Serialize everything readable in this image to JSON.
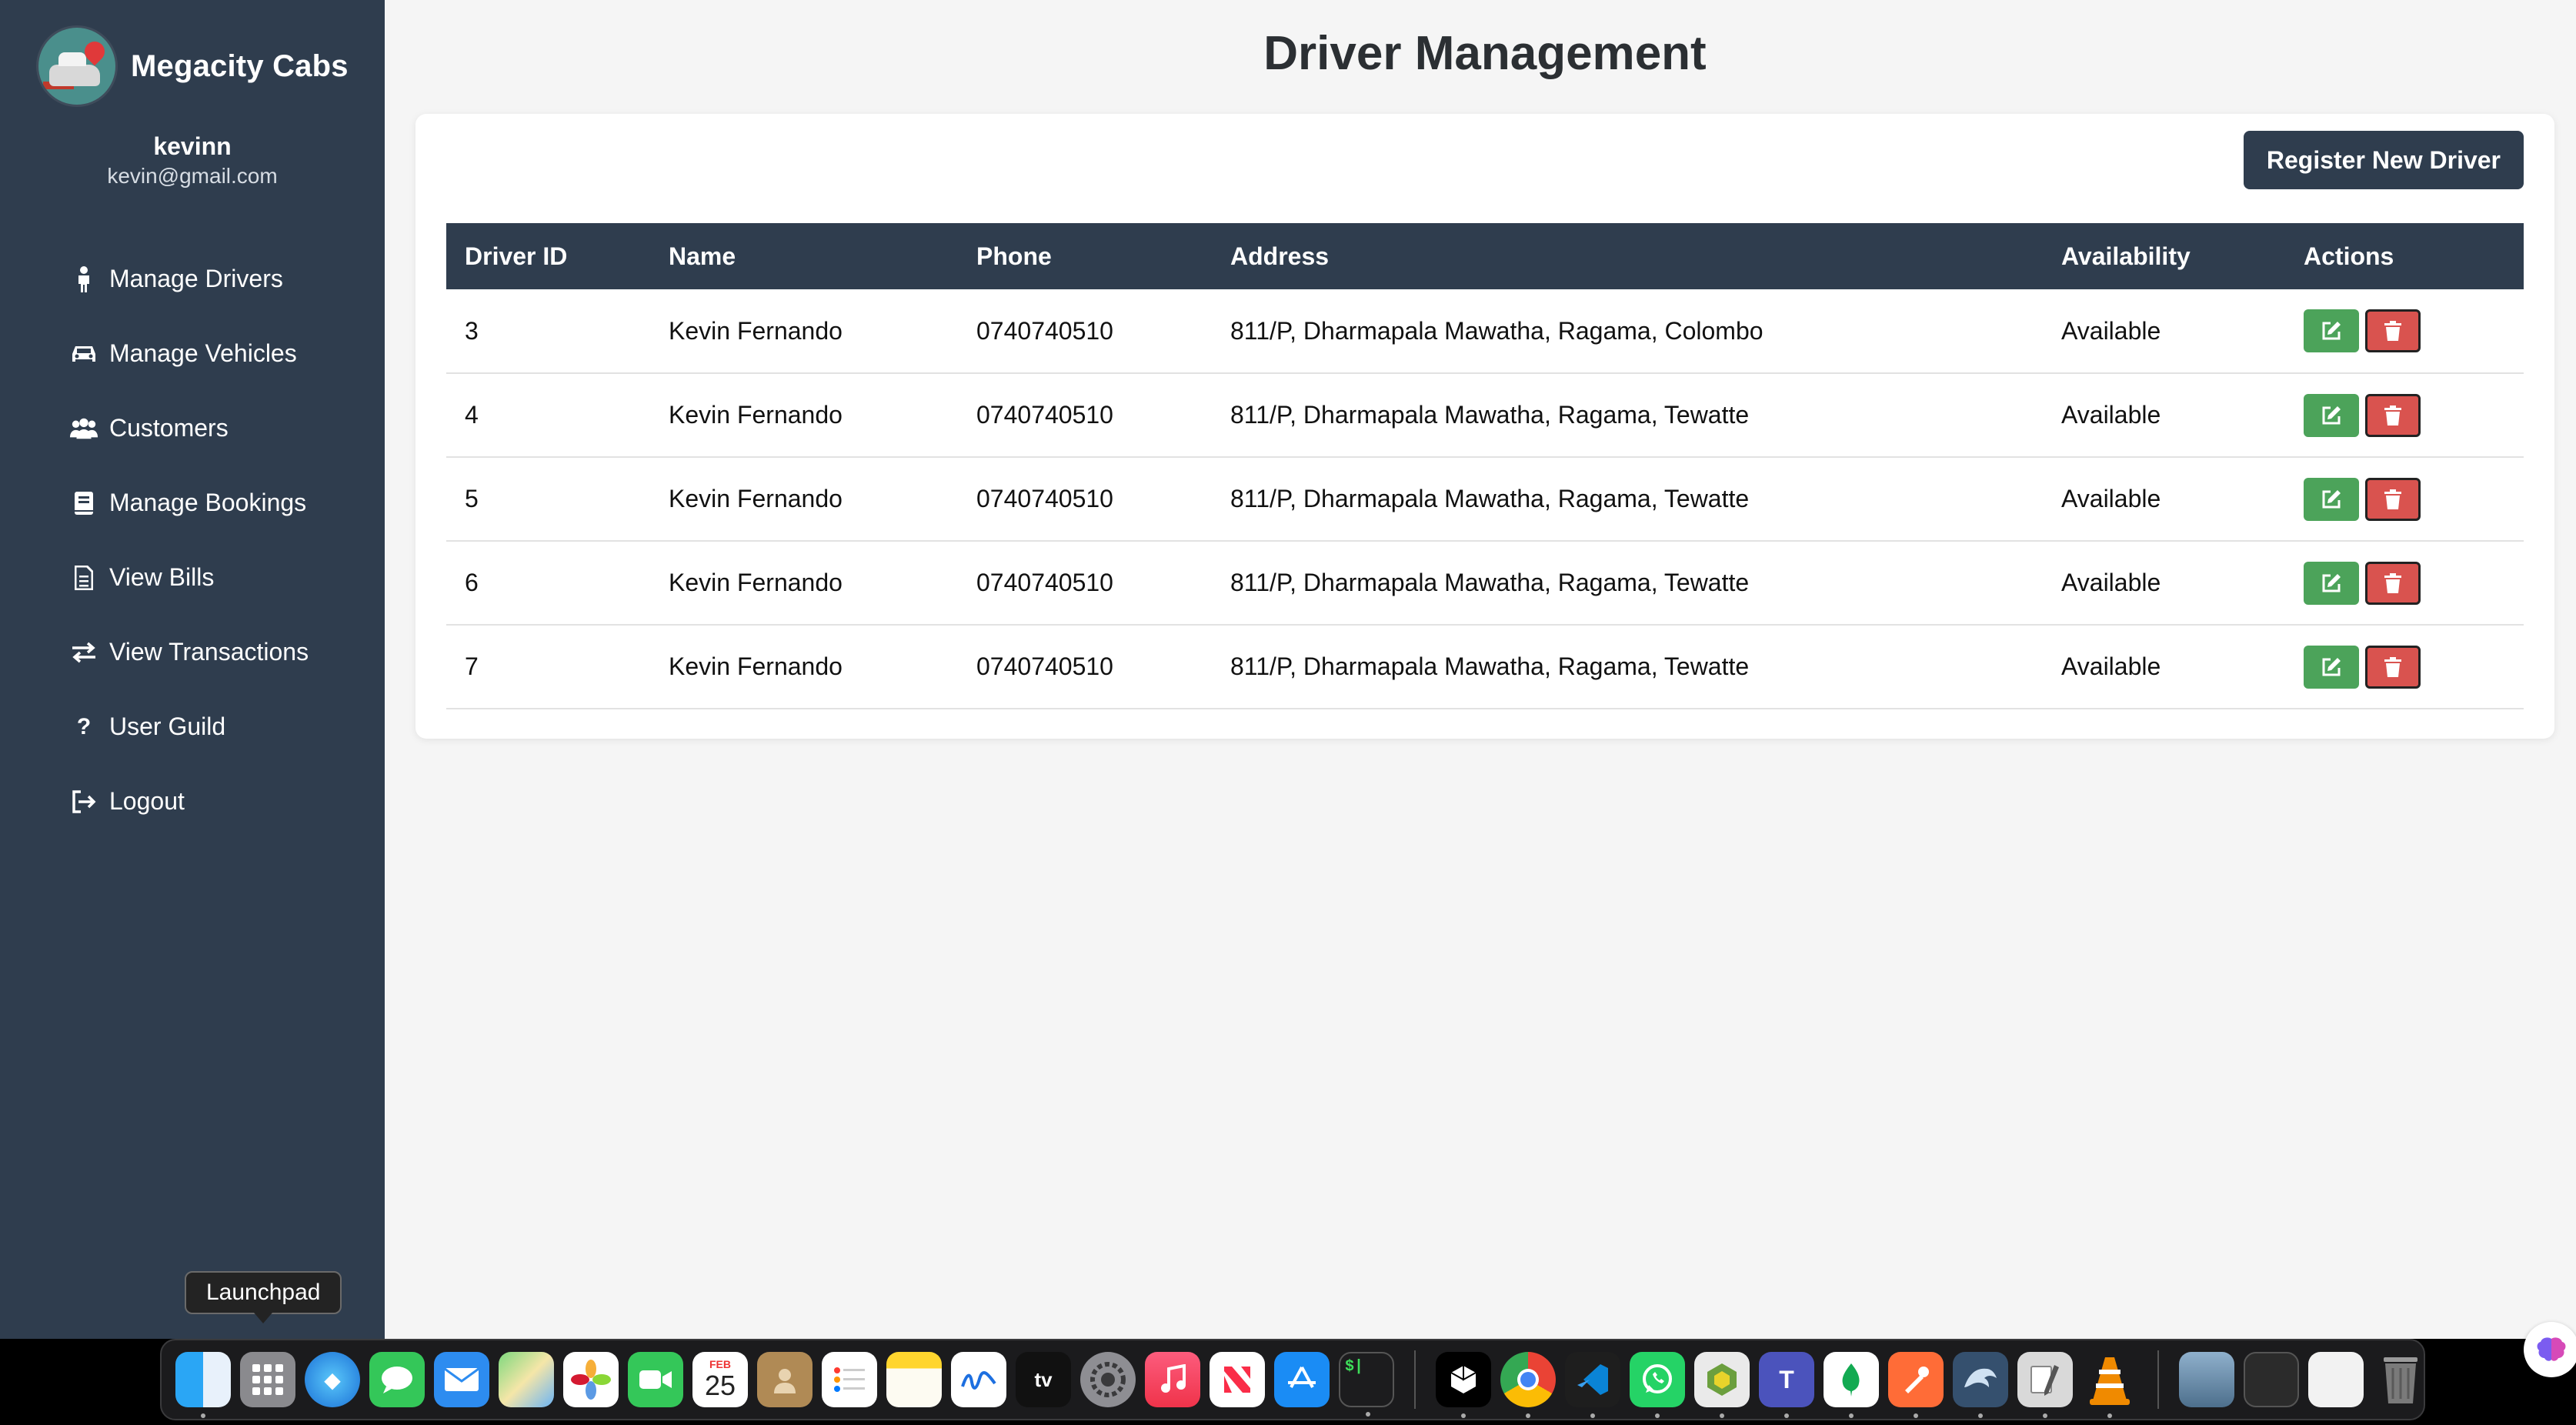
{
  "app": {
    "brand_name": "Megacity Cabs",
    "user_name": "kevinn",
    "user_email": "kevin@gmail.com"
  },
  "sidebar": {
    "items": [
      {
        "label": "Manage Drivers",
        "icon": "person-icon"
      },
      {
        "label": "Manage Vehicles",
        "icon": "car-icon"
      },
      {
        "label": "Customers",
        "icon": "users-icon"
      },
      {
        "label": "Manage Bookings",
        "icon": "book-icon"
      },
      {
        "label": "View Bills",
        "icon": "file-icon"
      },
      {
        "label": "View Transactions",
        "icon": "exchange-icon"
      },
      {
        "label": "User Guild",
        "icon": "question-icon"
      },
      {
        "label": "Logout",
        "icon": "logout-icon"
      }
    ]
  },
  "main": {
    "title": "Driver Management",
    "register_button": "Register New Driver",
    "table": {
      "headers": [
        "Driver ID",
        "Name",
        "Phone",
        "Address",
        "Availability",
        "Actions"
      ],
      "rows": [
        {
          "id": "3",
          "name": "Kevin Fernando",
          "phone": "0740740510",
          "address": "811/P, Dharmapala Mawatha, Ragama, Colombo",
          "availability": "Available"
        },
        {
          "id": "4",
          "name": "Kevin Fernando",
          "phone": "0740740510",
          "address": "811/P, Dharmapala Mawatha, Ragama, Tewatte",
          "availability": "Available"
        },
        {
          "id": "5",
          "name": "Kevin Fernando",
          "phone": "0740740510",
          "address": "811/P, Dharmapala Mawatha, Ragama, Tewatte",
          "availability": "Available"
        },
        {
          "id": "6",
          "name": "Kevin Fernando",
          "phone": "0740740510",
          "address": "811/P, Dharmapala Mawatha, Ragama, Tewatte",
          "availability": "Available"
        },
        {
          "id": "7",
          "name": "Kevin Fernando",
          "phone": "0740740510",
          "address": "811/P, Dharmapala Mawatha, Ragama, Tewatte",
          "availability": "Available"
        }
      ]
    }
  },
  "dock": {
    "tooltip": "Launchpad",
    "calendar_month": "FEB",
    "calendar_day": "25",
    "tv_label": "tv"
  },
  "colors": {
    "sidebar_bg": "#2f3d4e",
    "edit_button": "#4ca35a",
    "delete_button": "#d9534f",
    "page_bg": "#f5f5f5"
  }
}
